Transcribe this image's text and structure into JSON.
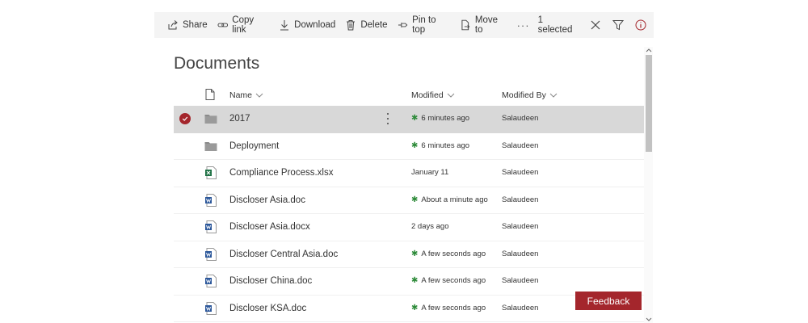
{
  "commandbar": {
    "share": "Share",
    "copy_link": "Copy link",
    "download": "Download",
    "delete": "Delete",
    "pin": "Pin to top",
    "move": "Move to",
    "more": "···",
    "selected": "1 selected"
  },
  "page": {
    "title": "Documents"
  },
  "columns": {
    "name": "Name",
    "modified": "Modified",
    "modified_by": "Modified By"
  },
  "rows": [
    {
      "type": "folder",
      "name": "2017",
      "modified": "6 minutes ago",
      "recent": true,
      "by": "Salaudeen",
      "selected": true
    },
    {
      "type": "folder",
      "name": "Deployment",
      "modified": "6 minutes ago",
      "recent": true,
      "by": "Salaudeen",
      "selected": false
    },
    {
      "type": "excel",
      "name": "Compliance Process.xlsx",
      "modified": "January 11",
      "recent": false,
      "by": "Salaudeen",
      "selected": false
    },
    {
      "type": "word",
      "name": "Discloser Asia.doc",
      "modified": "About a minute ago",
      "recent": true,
      "by": "Salaudeen",
      "selected": false
    },
    {
      "type": "word",
      "name": "Discloser Asia.docx",
      "modified": "2 days ago",
      "recent": false,
      "by": "Salaudeen",
      "selected": false
    },
    {
      "type": "word",
      "name": "Discloser Central Asia.doc",
      "modified": "A few seconds ago",
      "recent": true,
      "by": "Salaudeen",
      "selected": false
    },
    {
      "type": "word",
      "name": "Discloser China.doc",
      "modified": "A few seconds ago",
      "recent": true,
      "by": "Salaudeen",
      "selected": false
    },
    {
      "type": "word",
      "name": "Discloser KSA.doc",
      "modified": "A few seconds ago",
      "recent": true,
      "by": "Salaudeen",
      "selected": false
    }
  ],
  "feedback": {
    "label": "Feedback"
  },
  "colors": {
    "accent": "#a4262c",
    "recent_star": "#2e8b3a",
    "selected_row": "#d8d8d8",
    "commandbar": "#f4f4f4"
  }
}
